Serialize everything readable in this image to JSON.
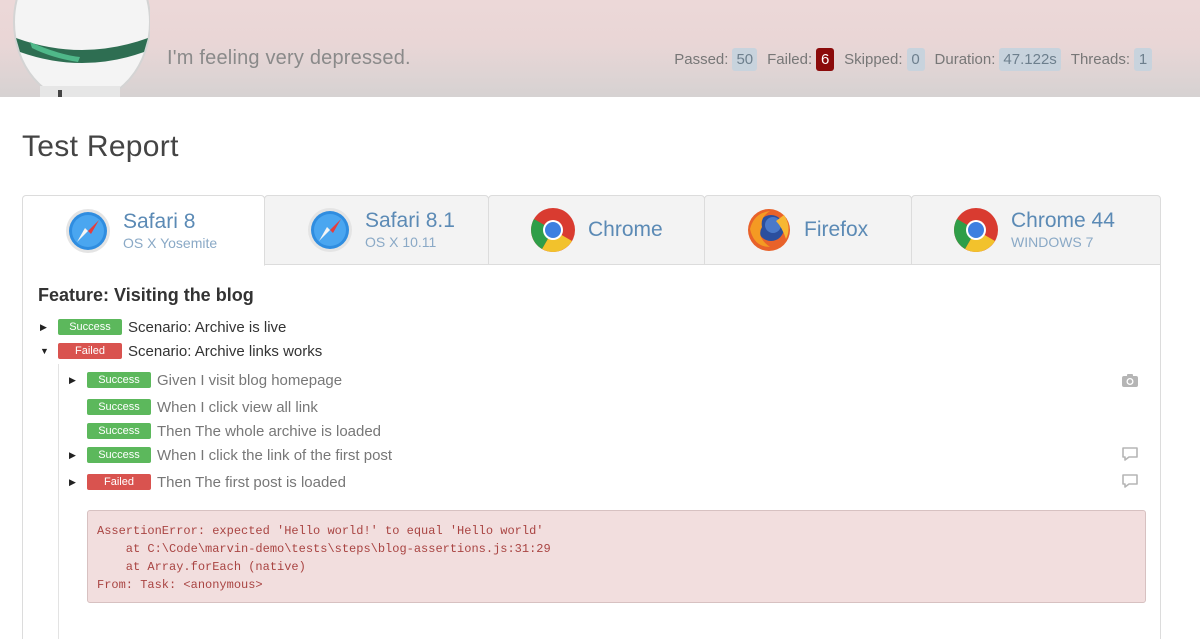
{
  "header": {
    "tagline": "I'm feeling very depressed.",
    "stats": [
      {
        "label": "Passed:",
        "value": "50"
      },
      {
        "label": "Failed:",
        "value": "6"
      },
      {
        "label": "Skipped:",
        "value": "0"
      },
      {
        "label": "Duration:",
        "value": "47.122s"
      },
      {
        "label": "Threads:",
        "value": "1"
      }
    ]
  },
  "page": {
    "title": "Test Report"
  },
  "tabs": [
    {
      "name": "Safari 8",
      "sub": "OS X Yosemite",
      "icon": "safari-icon",
      "active": true
    },
    {
      "name": "Safari 8.1",
      "sub": "OS X 10.11",
      "icon": "safari-icon"
    },
    {
      "name": "Chrome",
      "sub": "",
      "icon": "chrome-icon"
    },
    {
      "name": "Firefox",
      "sub": "",
      "icon": "firefox-icon"
    },
    {
      "name": "Chrome 44",
      "sub": "WINDOWS 7",
      "icon": "chrome-icon"
    }
  ],
  "feature": {
    "title": "Feature: Visiting the blog",
    "scenarios": [
      {
        "status": "Success",
        "title": "Scenario: Archive is live"
      },
      {
        "status": "Failed",
        "title": "Scenario: Archive links works"
      }
    ],
    "steps": [
      {
        "status": "Success",
        "text": "Given I visit blog homepage",
        "side_icon": "camera-icon"
      },
      {
        "status": "Success",
        "text": "When I click view all link"
      },
      {
        "status": "Success",
        "text": "Then The whole archive is loaded"
      },
      {
        "status": "Success",
        "text": "When I click the link of the first post",
        "side_icon": "comment-icon"
      },
      {
        "status": "Failed",
        "text": "Then The first post is loaded",
        "side_icon": "comment-icon"
      }
    ],
    "error": "AssertionError: expected 'Hello world!' to equal 'Hello world'\n    at C:\\Code\\marvin-demo\\tests\\steps\\blog-assertions.js:31:29\n    at Array.forEach (native)\nFrom: Task: <anonymous>"
  },
  "colors": {
    "success": "#5cb85c",
    "failed": "#d9534f",
    "failed_count": "#8b0b0b",
    "tab_text": "#5b8ab5",
    "error_bg": "#f2dede",
    "error_text": "#a94442"
  }
}
